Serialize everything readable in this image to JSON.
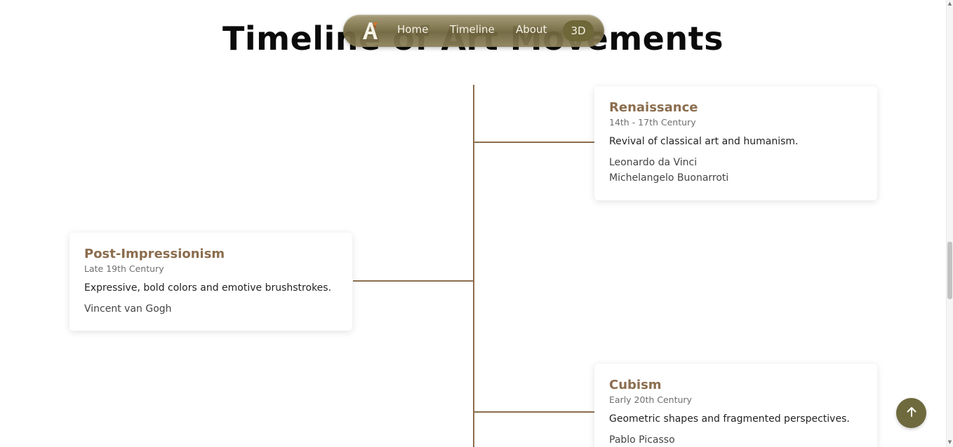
{
  "page": {
    "title": "Timeline of Art Movements"
  },
  "nav": {
    "logo_icon": "stylized-letter-a-logo-with-butterfly",
    "items": [
      {
        "label": "Home"
      },
      {
        "label": "Timeline"
      },
      {
        "label": "About"
      },
      {
        "label": "3D"
      }
    ],
    "active": "3D",
    "accent_color": "#6e6738"
  },
  "timeline": {
    "line_color": "#8b6d4e",
    "entries": [
      {
        "title": "Renaissance",
        "period": "14th - 17th Century",
        "description": "Revival of classical art and humanism.",
        "artists": [
          "Leonardo da Vinci",
          "Michelangelo Buonarroti"
        ]
      },
      {
        "title": "Post-Impressionism",
        "period": "Late 19th Century",
        "description": "Expressive, bold colors and emotive brushstrokes.",
        "artists": [
          "Vincent van Gogh"
        ]
      },
      {
        "title": "Cubism",
        "period": "Early 20th Century",
        "description": "Geometric shapes and fragmented perspectives.",
        "artists": [
          "Pablo Picasso"
        ]
      }
    ]
  },
  "scroll_top": {
    "icon": "arrow-up-icon",
    "color": "#6e6a3e"
  }
}
